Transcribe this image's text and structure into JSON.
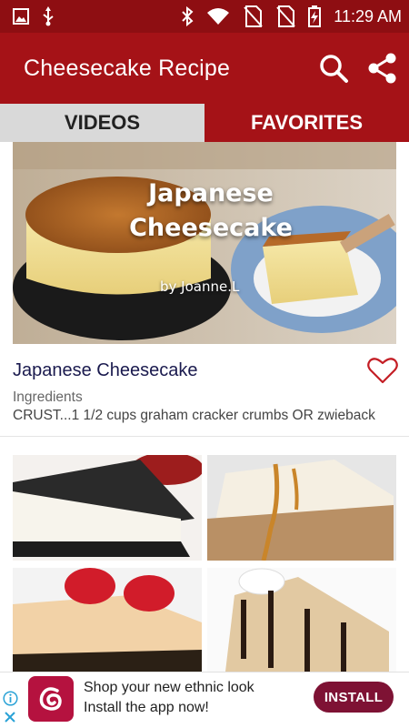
{
  "status_bar": {
    "time": "11:29 AM",
    "icons": [
      "image-icon",
      "usb-icon",
      "bluetooth-icon",
      "wifi-icon",
      "no-sim-icon",
      "no-sim-icon",
      "battery-charging-icon"
    ]
  },
  "app_bar": {
    "title": "Cheesecake Recipe",
    "icons": [
      "search-icon",
      "share-icon"
    ]
  },
  "tabs": [
    {
      "label": "VIDEOS",
      "selected": false
    },
    {
      "label": "FAVORITES",
      "selected": true
    }
  ],
  "featured": {
    "overlay_title_line1": "Japanese",
    "overlay_title_line2": "Cheesecake",
    "overlay_byline": "by Joanne.L",
    "title": "Japanese Cheesecake",
    "subtitle": "Ingredients",
    "description": "CRUST...1 1/2 cups graham cracker crumbs OR zwieback"
  },
  "ad": {
    "line1": "Shop your new ethnic look",
    "line2": "Install the app now!",
    "install_label": "INSTALL"
  },
  "colors": {
    "status_bar": "#8e0e12",
    "app_bar": "#a51217",
    "tab_unselected": "#d9d9d9",
    "accent": "#a51217",
    "install_button": "#7e1234"
  }
}
